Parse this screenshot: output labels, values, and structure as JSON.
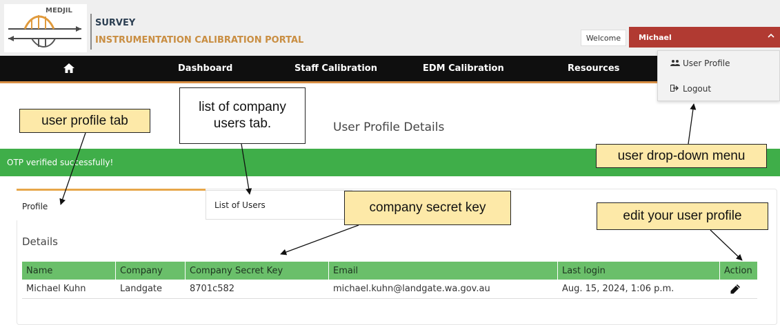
{
  "header": {
    "logo_text": "MEDJIL",
    "brand_line1": "SURVEY",
    "brand_line2": "INSTRUMENTATION CALIBRATION PORTAL",
    "welcome_text": "Welcome",
    "user_name": "Michael",
    "chevron_icon": "chevron-up-icon"
  },
  "nav": {
    "home_icon": "home-icon",
    "items": [
      {
        "label": "Dashboard"
      },
      {
        "label": "Staff Calibration"
      },
      {
        "label": "EDM Calibration"
      },
      {
        "label": "Resources"
      }
    ],
    "accent_color": "#d88f45"
  },
  "user_dropdown": {
    "items": [
      {
        "label": "User Profile",
        "icon": "users-icon"
      },
      {
        "label": "Logout",
        "icon": "logout-icon"
      }
    ]
  },
  "page": {
    "title": "User Profile Details"
  },
  "alert": {
    "message": "OTP verified successfully!",
    "color": "#3fae49"
  },
  "tabs": [
    {
      "label": "Profile",
      "active": true
    },
    {
      "label": "List of Users",
      "active": false
    }
  ],
  "details": {
    "heading": "Details",
    "columns": [
      "Name",
      "Company",
      "Company Secret Key",
      "Email",
      "Last login",
      "Action"
    ],
    "rows": [
      {
        "name": "Michael Kuhn",
        "company": "Landgate",
        "secret_key": "8701c582",
        "email": "michael.kuhn@landgate.wa.gov.au",
        "last_login": "Aug. 15, 2024, 1:06 p.m.",
        "action_icon": "pencil-icon"
      }
    ],
    "header_color": "#6abf6a"
  },
  "annotations": {
    "user_profile_tab": "user profile tab",
    "list_users_tab": "list of company users tab.",
    "user_dropdown_menu": "user drop-down menu",
    "company_secret_key": "company secret key",
    "edit_profile": "edit your user profile"
  }
}
